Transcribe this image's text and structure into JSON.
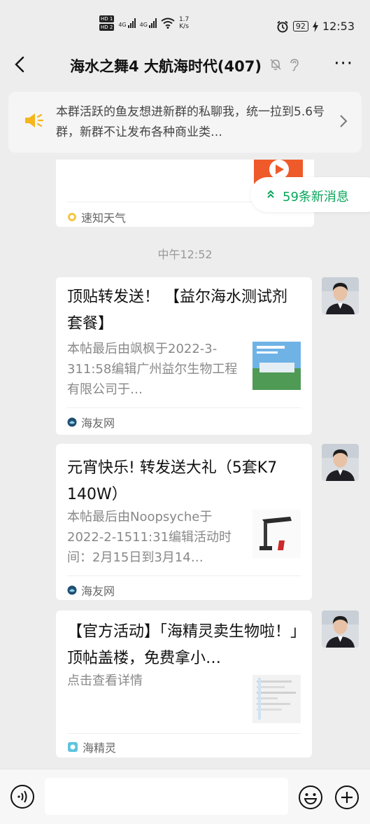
{
  "status_bar": {
    "hd1": "HD 1",
    "hd2": "HD 2",
    "net1": "4G",
    "net2": "4G",
    "speed_value": "1.7",
    "speed_unit": "K/s",
    "battery": "92",
    "time": "12:53"
  },
  "header": {
    "title": "海水之舞4 大航海时代(407)"
  },
  "notice": {
    "text": "本群活跃的鱼友想进新群的私聊我，统一拉到5.6号群，新群不让发布各种商业类…"
  },
  "new_messages": {
    "label": "59条新消息"
  },
  "partial_card": {
    "source": "速知天气"
  },
  "timestamp": "中午12:52",
  "messages": [
    {
      "title": "顶贴转发送！ 【益尔海水测试剂套餐】",
      "desc": "本帖最后由飒枫于2022-3-311:58编辑广州益尔生物工程有限公司于…",
      "source": "海友网"
    },
    {
      "title": "元宵快乐! 转发送大礼（5套K7 140W）",
      "desc": "本帖最后由Noopsyche于2022-2-1511:31编辑活动时间：2月15日到3月14…",
      "source": "海友网"
    },
    {
      "title": "【官方活动】「海精灵卖生物啦！」顶帖盖楼，免费拿小…",
      "desc": "点击查看详情",
      "source": "海精灵"
    }
  ],
  "colors": {
    "accent_green": "#07a65a",
    "horn_yellow": "#f5b61c",
    "background": "#ededed"
  }
}
